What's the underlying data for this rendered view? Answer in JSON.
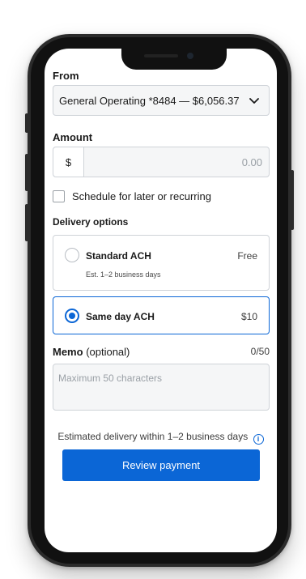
{
  "from": {
    "label": "From",
    "selected": "General Operating *8484 — $6,056.37"
  },
  "amount": {
    "label": "Amount",
    "currency": "$",
    "placeholder": "0.00"
  },
  "schedule": {
    "label": "Schedule for later or recurring",
    "checked": false
  },
  "delivery": {
    "label": "Delivery options",
    "options": [
      {
        "title": "Standard ACH",
        "subtitle": "Est. 1–2 business days",
        "price": "Free",
        "selected": false
      },
      {
        "title": "Same day ACH",
        "price": "$10",
        "selected": true
      }
    ]
  },
  "memo": {
    "label": "Memo",
    "optional": "(optional)",
    "counter": "0/50",
    "placeholder": "Maximum 50 characters"
  },
  "estimate": "Estimated delivery within 1–2 business days",
  "review_button": "Review payment",
  "colors": {
    "accent": "#0b66d6",
    "border": "#cfd3d8",
    "field_bg": "#f5f6f7"
  }
}
